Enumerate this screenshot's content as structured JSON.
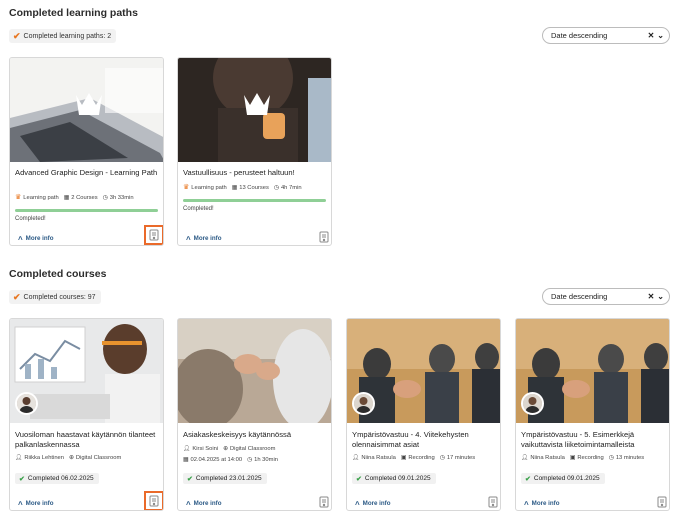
{
  "paths_section": {
    "title": "Completed learning paths",
    "count_label": "Completed learning paths: 2",
    "sort": {
      "value": "Date descending"
    }
  },
  "courses_section": {
    "title": "Completed courses",
    "count_label": "Completed courses: 97",
    "sort": {
      "value": "Date descending"
    }
  },
  "path_cards": [
    {
      "title": "Advanced Graphic Design - Learning Path",
      "type": "Learning path",
      "courses": "2 Courses",
      "duration": "3h 33min",
      "progress": 1.0,
      "status": "Completed!",
      "more": "More info"
    },
    {
      "title": "Vastuullisuus - perusteet haltuun!",
      "type": "Learning path",
      "courses": "13 Courses",
      "duration": "4h 7min",
      "progress": 1.0,
      "status": "Completed!",
      "more": "More info"
    }
  ],
  "course_cards": [
    {
      "title": "Vuosiloman haastavat käytännön tilanteet palkanlaskennassa",
      "teacher": "Riikka Lehtinen",
      "format": "Digital Classroom",
      "badge": "Completed 06.02.2025",
      "more": "More info"
    },
    {
      "title": "Asiakaskeskeisyys käytännössä",
      "teacher": "Kirsi Soini",
      "format": "Digital Classroom",
      "date": "02.04.2025 at 14:00",
      "duration": "1h 30min",
      "badge": "Completed 23.01.2025",
      "more": "More info"
    },
    {
      "title": "Ympäristövastuu - 4. Viitekehysten olennaisimmat asiat",
      "teacher": "Niina Ratsula",
      "format": "Recording",
      "duration": "17 minutes",
      "badge": "Completed 09.01.2025",
      "more": "More info"
    },
    {
      "title": "Ympäristövastuu - 5. Esimerkkejä vaikuttavista liiketoimintamalleista",
      "teacher": "Niina Ratsula",
      "format": "Recording",
      "duration": "13 minutes",
      "badge": "Completed 09.01.2025",
      "more": "More info"
    }
  ],
  "colors": {
    "accent": "#e87722",
    "progress": "#8fcf96",
    "link": "#2c5a86",
    "highlight": "#ea6a2a"
  },
  "icons": [
    "check-icon",
    "crown-icon",
    "courses-icon",
    "clock-icon",
    "person-icon",
    "globe-icon",
    "calendar-icon",
    "recording-icon",
    "chevron-up-icon",
    "certificate-icon",
    "clear-icon",
    "chevron-down-icon"
  ]
}
